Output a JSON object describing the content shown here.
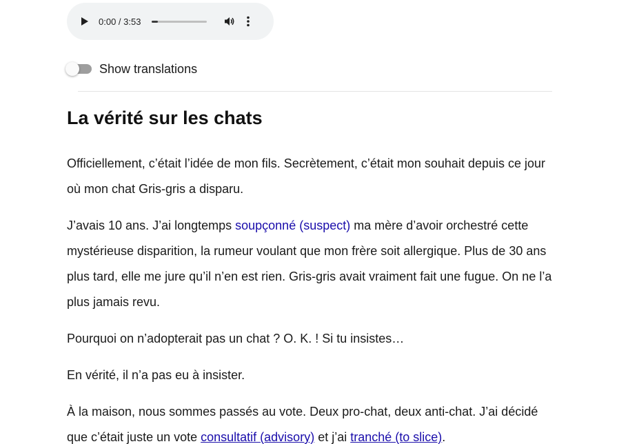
{
  "audio": {
    "current_time": "0:00",
    "separator": " / ",
    "duration": "3:53",
    "progress": 0.0,
    "play_icon": "play-icon",
    "volume_icon": "volume-icon",
    "menu_icon": "more-vert-icon"
  },
  "toggle": {
    "label": "Show translations",
    "checked": false
  },
  "article": {
    "title": "La vérité sur les chats",
    "p1": "Officiellement, c’était l’idée de mon fils. Secrètement, c’était mon souhait depuis ce jour où mon chat Gris-gris a disparu.",
    "p2": {
      "before": "J’avais 10 ans. J’ai longtemps ",
      "link": "soupçonné (suspect)",
      "after": " ma mère d’avoir orchestré cette mystérieuse disparition, la rumeur voulant que mon frère soit allergique. Plus de 30 ans plus tard, elle me jure qu’il n’en est rien. Gris-gris avait vraiment fait une fugue. On ne l’a plus jamais revu."
    },
    "p3": "Pourquoi on n’adopterait pas un chat ? O. K. ! Si tu insistes…",
    "p4": "En vérité, il n’a pas eu à insister.",
    "p5": {
      "before": "À la maison, nous sommes passés au vote. Deux pro-chat, deux anti-chat. J’ai décidé que c’était juste un vote ",
      "link1": "consultatif (advisory)",
      "middle": " et j’ai ",
      "link2": "tranché (to slice)",
      "after": "."
    }
  },
  "colors": {
    "link": "#1a0dab",
    "player_bg": "#f1f3f4",
    "toggle_track": "#9e9e9e"
  }
}
